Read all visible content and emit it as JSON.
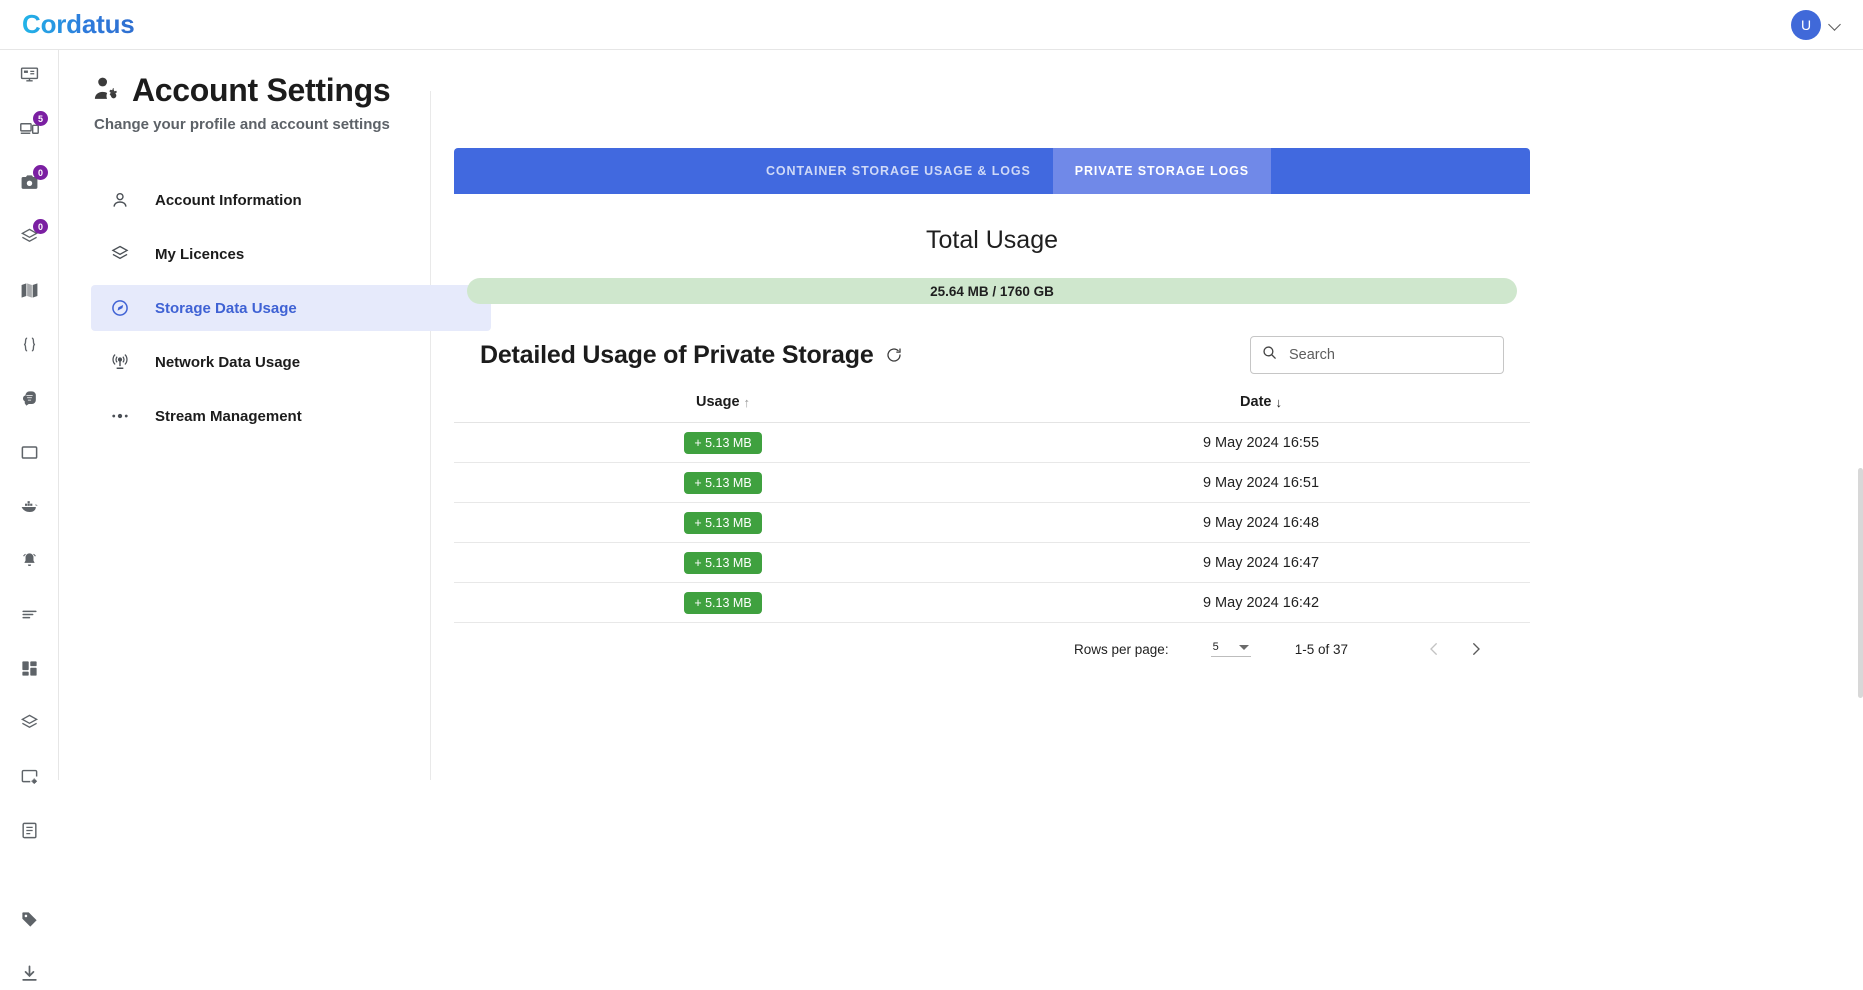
{
  "topbar": {
    "brand": "Cordatus",
    "avatar_initial": "U",
    "caret_icon": "chevron-down-icon"
  },
  "rail": {
    "items": [
      {
        "icon": "monitor-icon",
        "badge": null
      },
      {
        "icon": "devices-icon",
        "badge": "5"
      },
      {
        "icon": "camera-icon",
        "badge": "0"
      },
      {
        "icon": "layers-icon",
        "badge": "0"
      },
      {
        "icon": "map-icon",
        "badge": null
      },
      {
        "icon": "code-braces-icon",
        "badge": null
      },
      {
        "icon": "brain-icon",
        "badge": null
      },
      {
        "icon": "window-icon",
        "badge": null
      },
      {
        "icon": "docker-whale-icon",
        "badge": null
      },
      {
        "icon": "bell-icon",
        "badge": null
      },
      {
        "icon": "lines-icon",
        "badge": null
      },
      {
        "icon": "dashboard-grid-icon",
        "badge": null
      },
      {
        "icon": "stack-layers-icon",
        "badge": null
      },
      {
        "icon": "window-settings-icon",
        "badge": null
      },
      {
        "icon": "document-icon",
        "badge": null
      },
      {
        "icon": "tag-icon",
        "badge": null
      },
      {
        "icon": "download-icon",
        "badge": null
      }
    ]
  },
  "header": {
    "icon": "account-settings-icon",
    "title": "Account Settings",
    "subtitle": "Change your profile and account settings"
  },
  "settings_nav": {
    "items": [
      {
        "label": "Account Information",
        "icon": "person-icon",
        "active": false
      },
      {
        "label": "My Licences",
        "icon": "layers-icon",
        "active": false
      },
      {
        "label": "Storage Data Usage",
        "icon": "gauge-icon",
        "active": true
      },
      {
        "label": "Network Data Usage",
        "icon": "broadcast-icon",
        "active": false
      },
      {
        "label": "Stream Management",
        "icon": "stream-dots-icon",
        "active": false
      }
    ]
  },
  "tabs": [
    {
      "label": "CONTAINER STORAGE USAGE & LOGS",
      "active": false
    },
    {
      "label": "PRIVATE STORAGE LOGS",
      "active": true
    }
  ],
  "total_usage": {
    "title": "Total Usage",
    "value": "25.64 MB / 1760 GB",
    "bar_color": "#cfe7cd"
  },
  "detail": {
    "title": "Detailed Usage of Private Storage",
    "refresh_icon": "refresh-icon"
  },
  "search": {
    "icon": "search-icon",
    "placeholder": "Search",
    "value": ""
  },
  "table": {
    "columns": [
      {
        "label": "Usage",
        "sort": "↑"
      },
      {
        "label": "Date",
        "sort": "↓"
      }
    ],
    "rows": [
      {
        "usage": "+ 5.13 MB",
        "date": "9 May 2024 16:55"
      },
      {
        "usage": "+ 5.13 MB",
        "date": "9 May 2024 16:51"
      },
      {
        "usage": "+ 5.13 MB",
        "date": "9 May 2024 16:48"
      },
      {
        "usage": "+ 5.13 MB",
        "date": "9 May 2024 16:47"
      },
      {
        "usage": "+ 5.13 MB",
        "date": "9 May 2024 16:42"
      }
    ],
    "chip_color": "#3fa13f"
  },
  "pagination": {
    "rows_per_page_label": "Rows per page:",
    "rows_per_page_value": "5",
    "range": "1-5 of 37",
    "prev_icon": "chevron-left-icon",
    "next_icon": "chevron-right-icon"
  },
  "colors": {
    "brand_start": "#22b5e8",
    "brand_end": "#2f6fd0",
    "tab_bar": "#4169df",
    "tab_active": "#7089e8",
    "nav_active_bg": "#e6eafb",
    "nav_active_text": "#3f62d4",
    "badge": "#7b1fa2"
  }
}
